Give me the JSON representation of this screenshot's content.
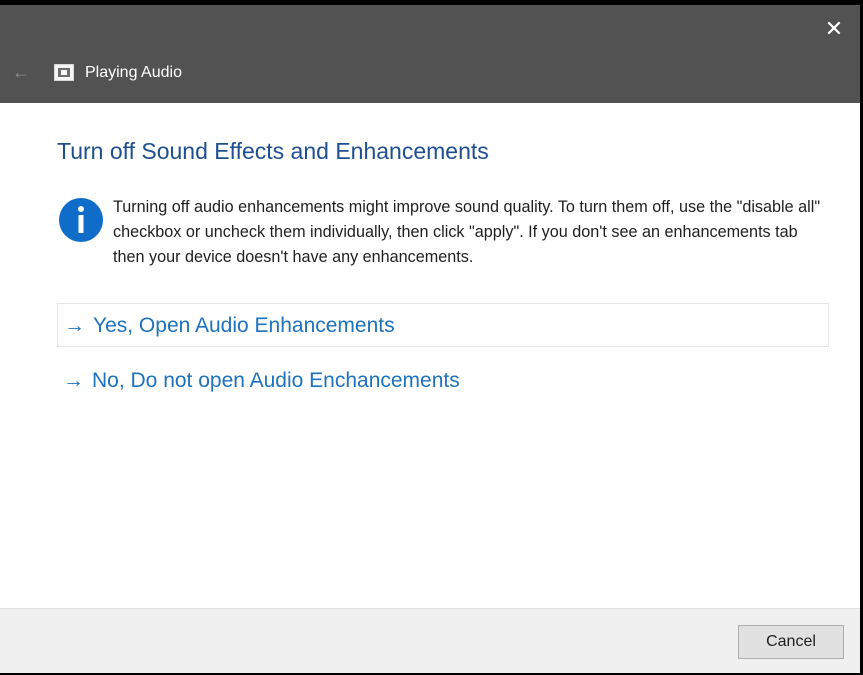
{
  "window": {
    "title": "Playing Audio",
    "close_glyph": "✕",
    "back_glyph": "←",
    "icons": {
      "close": "close-icon",
      "back": "back-arrow-icon",
      "app": "audio-troubleshooter-icon"
    }
  },
  "content": {
    "heading": "Turn off Sound Effects and Enhancements",
    "info_icon": "info-icon",
    "info_text": "Turning off audio enhancements might improve sound quality. To turn them off, use the \"disable all\" checkbox or uncheck them individually, then click \"apply\". If you don't see an enhancements tab then your device doesn't have any enhancements.",
    "options": [
      {
        "arrow": "→",
        "label": "Yes, Open Audio Enhancements"
      },
      {
        "arrow": "→",
        "label": "No, Do not open Audio Enchancements"
      }
    ]
  },
  "footer": {
    "cancel_label": "Cancel"
  },
  "colors": {
    "titlebar": "#525252",
    "heading": "#1d4f91",
    "link": "#1e73be",
    "info_icon": "#0f6cc9",
    "footer": "#f0f0f0"
  }
}
